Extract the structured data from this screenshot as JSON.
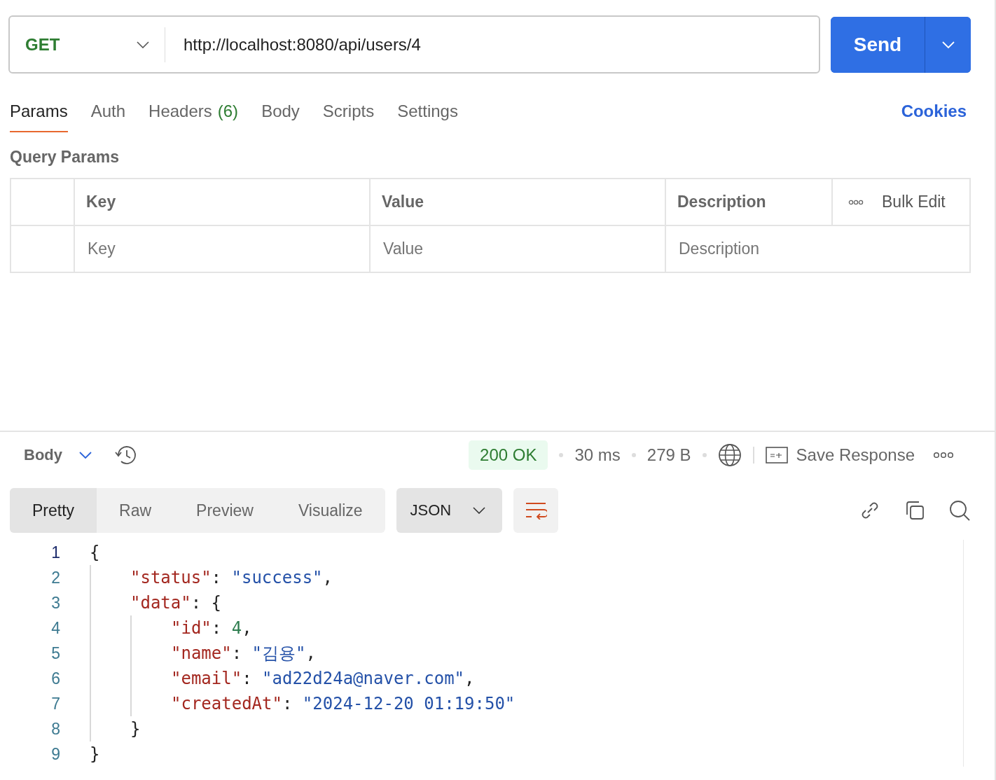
{
  "request": {
    "method": "GET",
    "url": "http://localhost:8080/api/users/4",
    "send_label": "Send"
  },
  "tabs": [
    {
      "label": "Params",
      "selected": true
    },
    {
      "label": "Auth",
      "selected": false
    },
    {
      "label": "Headers",
      "count": "(6)",
      "selected": false
    },
    {
      "label": "Body",
      "selected": false
    },
    {
      "label": "Scripts",
      "selected": false
    },
    {
      "label": "Settings",
      "selected": false
    }
  ],
  "cookies_link": "Cookies",
  "query_params": {
    "title": "Query Params",
    "columns": [
      "Key",
      "Value",
      "Description"
    ],
    "bulk_edit": "Bulk Edit",
    "placeholders": [
      "Key",
      "Value",
      "Description"
    ]
  },
  "response": {
    "section": "Body",
    "status": "200 OK",
    "time": "30 ms",
    "size": "279 B",
    "save_label": "Save Response",
    "views": [
      {
        "label": "Pretty",
        "selected": true
      },
      {
        "label": "Raw",
        "selected": false
      },
      {
        "label": "Preview",
        "selected": false
      },
      {
        "label": "Visualize",
        "selected": false
      }
    ],
    "format": "JSON",
    "code": [
      {
        "number": "1",
        "active": true,
        "tokens": [
          {
            "kind": "punct",
            "text": "{"
          }
        ],
        "children": [
          {
            "number": "2",
            "active": false,
            "tokens": [
              {
                "kind": "key",
                "text": "\"status\""
              },
              {
                "kind": "punct",
                "text": ": "
              },
              {
                "kind": "str",
                "text": "\"success\""
              },
              {
                "kind": "punct",
                "text": ","
              }
            ]
          },
          {
            "number": "3",
            "active": false,
            "tokens": [
              {
                "kind": "key",
                "text": "\"data\""
              },
              {
                "kind": "punct",
                "text": ": {"
              }
            ],
            "children": [
              {
                "number": "4",
                "active": false,
                "tokens": [
                  {
                    "kind": "key",
                    "text": "\"id\""
                  },
                  {
                    "kind": "punct",
                    "text": ": "
                  },
                  {
                    "kind": "num",
                    "text": "4"
                  },
                  {
                    "kind": "punct",
                    "text": ","
                  }
                ]
              },
              {
                "number": "5",
                "active": false,
                "tokens": [
                  {
                    "kind": "key",
                    "text": "\"name\""
                  },
                  {
                    "kind": "punct",
                    "text": ": "
                  },
                  {
                    "kind": "str",
                    "text": "\"김용\""
                  },
                  {
                    "kind": "punct",
                    "text": ","
                  }
                ]
              },
              {
                "number": "6",
                "active": false,
                "tokens": [
                  {
                    "kind": "key",
                    "text": "\"email\""
                  },
                  {
                    "kind": "punct",
                    "text": ": "
                  },
                  {
                    "kind": "str",
                    "text": "\"ad22d24a@naver.com\""
                  },
                  {
                    "kind": "punct",
                    "text": ","
                  }
                ]
              },
              {
                "number": "7",
                "active": false,
                "tokens": [
                  {
                    "kind": "key",
                    "text": "\"createdAt\""
                  },
                  {
                    "kind": "punct",
                    "text": ": "
                  },
                  {
                    "kind": "str",
                    "text": "\"2024-12-20 01:19:50\""
                  }
                ]
              }
            ]
          },
          {
            "number": "8",
            "active": false,
            "tokens": [
              {
                "kind": "punct",
                "text": "}"
              }
            ]
          }
        ]
      },
      {
        "number": "9",
        "active": false,
        "tokens": [
          {
            "kind": "punct",
            "text": "}"
          }
        ]
      }
    ]
  }
}
